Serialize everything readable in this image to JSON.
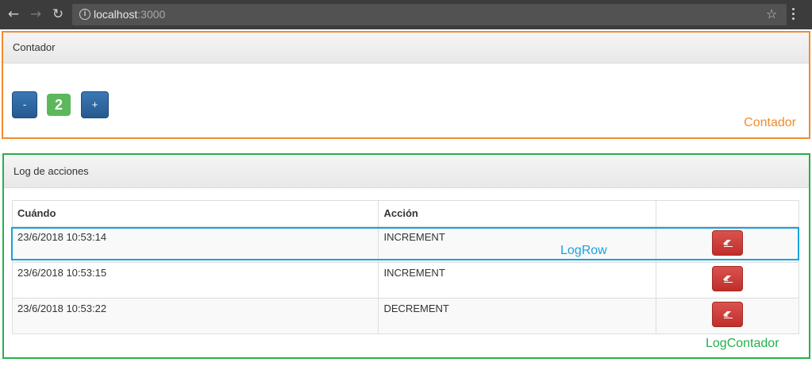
{
  "browser": {
    "url_host": "localhost",
    "url_port": ":3000"
  },
  "contador": {
    "title": "Contador",
    "minus_label": "-",
    "plus_label": "+",
    "count": "2"
  },
  "log": {
    "title": "Log de acciones",
    "headers": {
      "when": "Cuándo",
      "action": "Acción",
      "delete": ""
    },
    "rows": [
      {
        "when": "23/6/2018 10:53:14",
        "action": "INCREMENT"
      },
      {
        "when": "23/6/2018 10:53:15",
        "action": "INCREMENT"
      },
      {
        "when": "23/6/2018 10:53:22",
        "action": "DECREMENT"
      }
    ]
  },
  "annotations": {
    "contador": "Contador",
    "logrow": "LogRow",
    "logcontador": "LogContador",
    "colors": {
      "contador": "#f08c2f",
      "logrow": "#1aa2dd",
      "logcontador": "#25b04b"
    }
  },
  "icons": {
    "back": "arrow-left-icon",
    "forward": "arrow-right-icon",
    "reload": "reload-icon",
    "info": "info-icon",
    "bookmark": "star-icon",
    "menu": "kebab-menu-icon",
    "delete": "eraser-icon"
  },
  "colors": {
    "primary": "#337ab7",
    "success": "#5cb85c",
    "danger": "#d9534f"
  }
}
